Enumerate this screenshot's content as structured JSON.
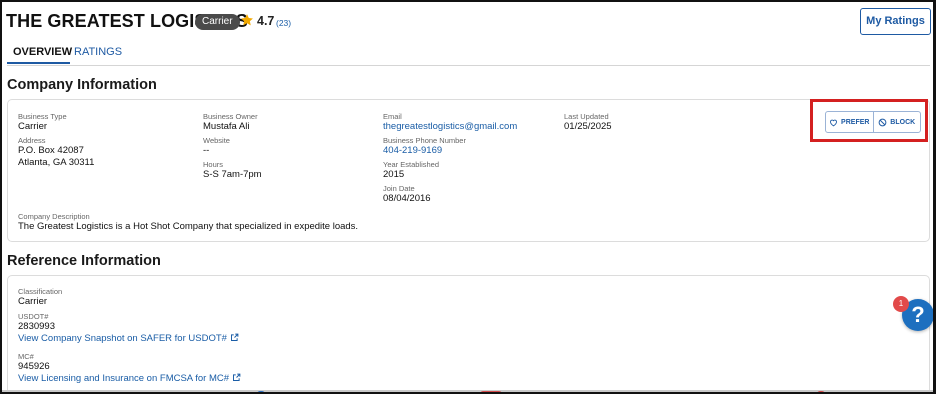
{
  "header": {
    "company_name": "THE GREATEST LOGISTICS",
    "type_badge": "Carrier",
    "rating": "4.7",
    "rating_count": "(23)",
    "my_ratings_label": "My Ratings"
  },
  "tabs": [
    {
      "label": "OVERVIEW",
      "active": true
    },
    {
      "label": "RATINGS",
      "active": false
    }
  ],
  "company_info": {
    "heading": "Company Information",
    "business_type": {
      "label": "Business Type",
      "value": "Carrier"
    },
    "address": {
      "label": "Address",
      "line1": "P.O. Box 42087",
      "line2": "Atlanta, GA 30311"
    },
    "business_owner": {
      "label": "Business Owner",
      "value": "Mustafa Ali"
    },
    "website": {
      "label": "Website",
      "value": "--"
    },
    "hours": {
      "label": "Hours",
      "value": "S-S 7am-7pm"
    },
    "email": {
      "label": "Email",
      "value": "thegreatestlogistics@gmail.com"
    },
    "phone": {
      "label": "Business Phone Number",
      "value": "404-219-9169"
    },
    "year_established": {
      "label": "Year Established",
      "value": "2015"
    },
    "join_date": {
      "label": "Join Date",
      "value": "08/04/2016"
    },
    "last_updated": {
      "label": "Last Updated",
      "value": "01/25/2025"
    },
    "description": {
      "label": "Company Description",
      "value": "The Greatest Logistics is a Hot Shot Company that specialized in expedite loads."
    },
    "actions": {
      "prefer_label": "PREFER",
      "block_label": "BLOCK"
    }
  },
  "reference_info": {
    "heading": "Reference Information",
    "classification": {
      "label": "Classification",
      "value": "Carrier"
    },
    "usdot": {
      "label": "USDOT#",
      "value": "2830993",
      "link": "View Company Snapshot on SAFER for USDOT#"
    },
    "mc": {
      "label": "MC#",
      "value": "945926",
      "link": "View Licensing and Insurance on FMCSA for MC#"
    }
  },
  "help": {
    "icon_text": "?",
    "badge_count": "1"
  },
  "colors": {
    "accent": "#1e5aa3",
    "link": "#1a5da6",
    "highlight": "#d42020",
    "star": "#f2a900"
  }
}
